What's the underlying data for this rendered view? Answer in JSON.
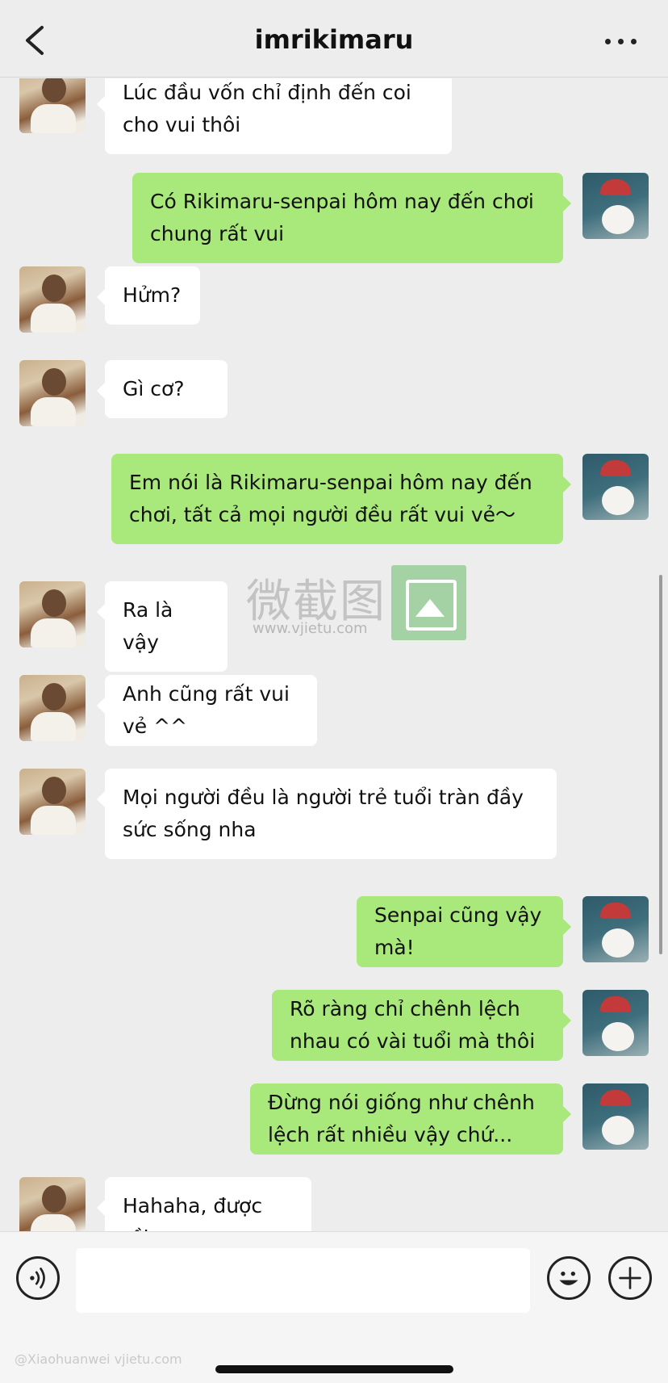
{
  "header": {
    "title": "imrikimaru"
  },
  "messages": [
    {
      "side": "in",
      "text": "Lúc đầu vốn chỉ định đến coi cho vui thôi"
    },
    {
      "side": "out",
      "text": "Có Rikimaru-senpai hôm nay đến chơi chung rất vui"
    },
    {
      "side": "in",
      "text": "Hửm?"
    },
    {
      "side": "in",
      "text": "Gì cơ?"
    },
    {
      "side": "out",
      "text": "Em nói là Rikimaru-senpai hôm nay đến chơi, tất cả mọi người đều rất vui vẻ〜"
    },
    {
      "side": "in",
      "text": "Ra là vậy"
    },
    {
      "side": "in",
      "text": "Anh cũng rất vui vẻ ^^"
    },
    {
      "side": "in",
      "text": "Mọi người đều là người trẻ tuổi tràn đầy sức sống nha"
    },
    {
      "side": "out",
      "text": "Senpai cũng vậy mà!"
    },
    {
      "side": "out",
      "text": "Rõ ràng chỉ chênh lệch nhau có vài tuổi mà thôi"
    },
    {
      "side": "out",
      "text": "Đừng nói giống như chênh lệch rất nhiều vậy chứ..."
    },
    {
      "side": "in",
      "text": "Hahaha, được rồi"
    }
  ],
  "watermark": {
    "text": "微截图",
    "url": "www.vjietu.com"
  },
  "footer_watermark": "@Xiaohuanwei  vjietu.com",
  "icons": {
    "back": "chevron-left-icon",
    "more": "more-dots-icon",
    "voice": "voice-icon",
    "emoji": "emoji-icon",
    "plus": "plus-icon"
  },
  "colors": {
    "incoming_bubble": "#ffffff",
    "outgoing_bubble": "#a9e87a",
    "background": "#ededed"
  }
}
